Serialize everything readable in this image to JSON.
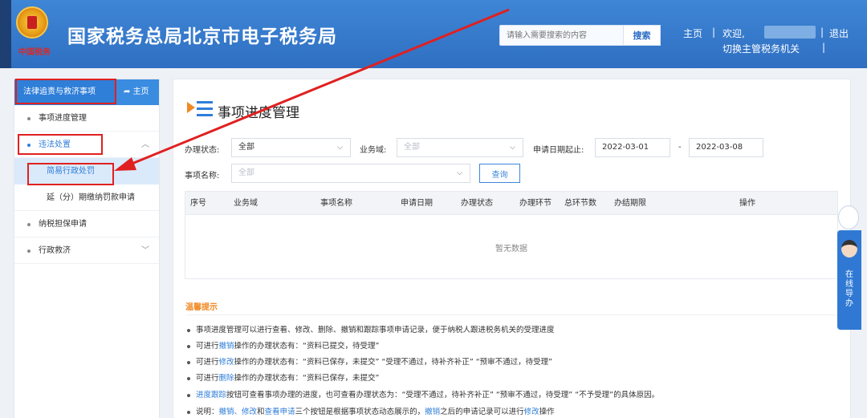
{
  "header": {
    "emblem_text": "中国税务",
    "site_title": "国家税务总局北京市电子税务局",
    "search_placeholder": "请输入需要搜索的内容",
    "search_button": "搜索",
    "nav_home": "主页",
    "nav_sep": "|",
    "welcome": "欢迎,",
    "logout": "退出",
    "switch_authority": "切换主管税务机关"
  },
  "sidebar": {
    "title": "法律追责与救济事项",
    "home": "主页",
    "items": [
      {
        "label": "事项进度管理"
      },
      {
        "label": "违法处置"
      },
      {
        "label": "简易行政处罚"
      },
      {
        "label": "延（分）期缴纳罚款申请"
      },
      {
        "label": "纳税担保申请"
      },
      {
        "label": "行政救济"
      }
    ]
  },
  "main": {
    "title": "事项进度管理",
    "filters": {
      "status_label": "办理状态:",
      "status_value": "全部",
      "domain_label": "业务域:",
      "domain_value": "全部",
      "date_label": "申请日期起止:",
      "date_start": "2022-03-01",
      "date_sep": "-",
      "date_end": "2022-03-08",
      "name_label": "事项名称:",
      "name_value": "全部",
      "query_button": "查询"
    },
    "table": {
      "columns": [
        "序号",
        "业务域",
        "事项名称",
        "申请日期",
        "办理状态",
        "办理环节",
        "总环节数",
        "办结期限",
        "操作"
      ],
      "empty_text": "暂无数据"
    },
    "tips": {
      "title": "温馨提示",
      "lines": [
        {
          "segments": [
            "事项进度管理可以进行查看、修改、删除、撤销和跟踪事项申请记录，便于纳税人跟进税务机关的受理进度"
          ]
        },
        {
          "segments": [
            "可进行",
            "撤销",
            "操作的办理状态有：“资料已提交，待受理”"
          ]
        },
        {
          "segments": [
            "可进行",
            "修改",
            "操作的办理状态有：“资料已保存，未提交” “受理不通过，待补齐补正” “预审不通过，待受理”"
          ]
        },
        {
          "segments": [
            "可进行",
            "删除",
            "操作的办理状态有：“资料已保存，未提交”"
          ]
        },
        {
          "segments": [
            "",
            "进度跟踪",
            "按钮可查看事项办理的进度，也可查看办理状态为：“受理不通过，待补齐补正” “预审不通过，待受理” “不予受理”的具体原因。"
          ]
        },
        {
          "segments": [
            "说明：",
            "撤销、修改",
            "和",
            "查看申请",
            "三个按钮是根据事项状态动态展示的，",
            "撤销",
            "之后的申请记录可以进行",
            "修改",
            "操作"
          ]
        }
      ]
    }
  },
  "float": {
    "label": "在线导办"
  },
  "colors": {
    "header_blue": "#3f86d6",
    "accent": "#2f7ed8",
    "annotation_red": "#e02020",
    "tip_orange": "#f08a24"
  }
}
